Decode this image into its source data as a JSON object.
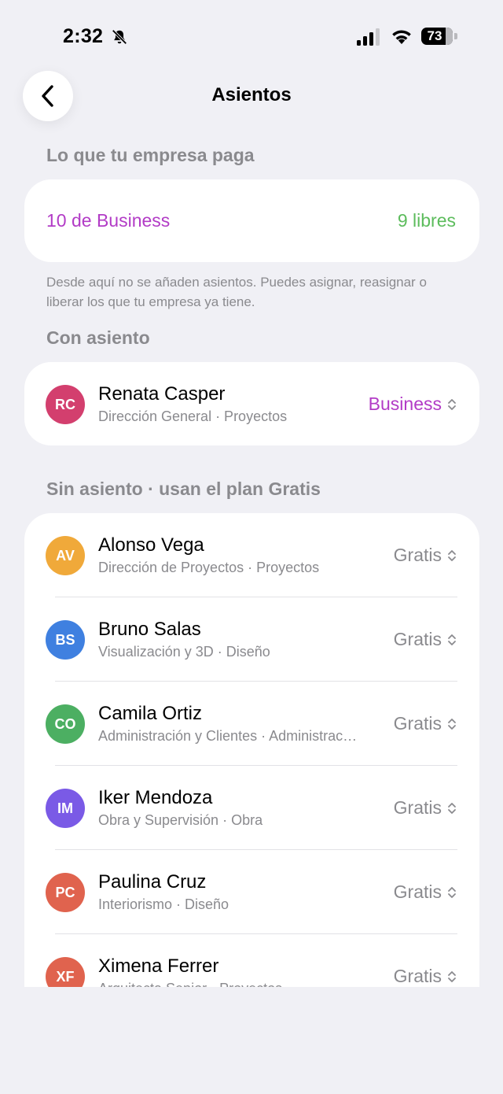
{
  "status_bar": {
    "time": "2:32",
    "battery": "73"
  },
  "nav": {
    "title": "Asientos"
  },
  "company_section": {
    "header": "Lo que tu empresa paga",
    "plan_name": "10 de Business",
    "free_count": "9 libres",
    "note": "Desde aquí no se añaden asientos. Puedes asignar, reasignar o liberar los que tu empresa ya tiene."
  },
  "assigned_section": {
    "header": "Con asiento",
    "members": [
      {
        "initials": "RC",
        "name": "Renata Casper",
        "subtitle": "Dirección General · Proyectos",
        "plan": "Business",
        "color": "#d33f6e"
      }
    ]
  },
  "unassigned_section": {
    "header": "Sin asiento · usan el plan Gratis",
    "members": [
      {
        "initials": "AV",
        "name": "Alonso Vega",
        "subtitle": "Dirección de Proyectos · Proyectos",
        "plan": "Gratis",
        "color": "#f0a93a"
      },
      {
        "initials": "BS",
        "name": "Bruno Salas",
        "subtitle": "Visualización y 3D · Diseño",
        "plan": "Gratis",
        "color": "#3f80e0"
      },
      {
        "initials": "CO",
        "name": "Camila Ortiz",
        "subtitle": "Administración y Clientes · Administración",
        "plan": "Gratis",
        "color": "#4caf62"
      },
      {
        "initials": "IM",
        "name": "Iker Mendoza",
        "subtitle": "Obra y Supervisión · Obra",
        "plan": "Gratis",
        "color": "#7a5ae6"
      },
      {
        "initials": "PC",
        "name": "Paulina Cruz",
        "subtitle": "Interiorismo · Diseño",
        "plan": "Gratis",
        "color": "#e0634e"
      },
      {
        "initials": "XF",
        "name": "Ximena Ferrer",
        "subtitle": "Arquitecta Senior · Proyectos",
        "plan": "Gratis",
        "color": "#e0634e"
      }
    ]
  },
  "colors": {
    "accent_business": "#b23bc6",
    "free_green": "#5cbc5c",
    "background": "#f0f0f5"
  },
  "icons": {
    "back": "chevron-left-icon",
    "picker": "chevron-updown-icon",
    "silent": "bell-slash-icon"
  }
}
